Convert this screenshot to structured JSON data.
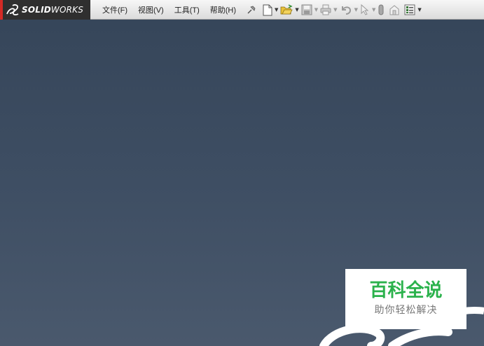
{
  "app": {
    "brand_prefix": "SOLID",
    "brand_suffix": "WORKS"
  },
  "menu": [
    {
      "label": "文件(F)"
    },
    {
      "label": "视图(V)"
    },
    {
      "label": "工具(T)"
    },
    {
      "label": "帮助(H)"
    }
  ],
  "toolbar_icons": [
    "pin-icon",
    "new-document-icon",
    "open-folder-icon",
    "save-icon",
    "print-icon",
    "undo-icon",
    "select-pointer-icon",
    "rebuild-icon",
    "file-properties-icon",
    "options-icon"
  ],
  "watermark": {
    "title": "百科全说",
    "subtitle": "助你轻松解决"
  },
  "colors": {
    "accent_red": "#d42a25",
    "brand_bg": "#2f2f2f",
    "workspace": "#3b4a5e",
    "watermark_green": "#2bb24c"
  }
}
